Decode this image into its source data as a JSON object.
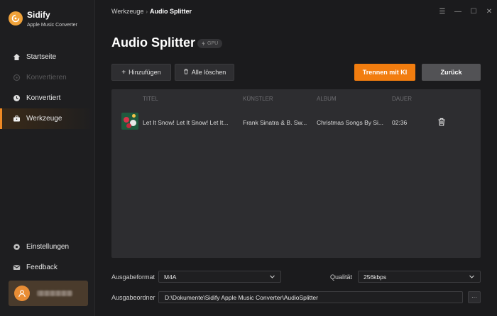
{
  "app": {
    "name": "Sidify",
    "subtitle": "Apple Music Converter",
    "accent_color": "#f27d0f"
  },
  "sidebar": {
    "items": [
      {
        "label": "Startseite",
        "icon": "home-icon",
        "state": "normal"
      },
      {
        "label": "Konvertieren",
        "icon": "convert-icon",
        "state": "disabled"
      },
      {
        "label": "Konvertiert",
        "icon": "clock-icon",
        "state": "normal"
      },
      {
        "label": "Werkzeuge",
        "icon": "toolbox-icon",
        "state": "active"
      }
    ],
    "bottom_items": [
      {
        "label": "Einstellungen",
        "icon": "gear-icon"
      },
      {
        "label": "Feedback",
        "icon": "mail-icon"
      }
    ]
  },
  "breadcrumb": {
    "parent": "Werkzeuge",
    "separator": "›",
    "current": "Audio Splitter"
  },
  "window_controls": {
    "menu": "☰",
    "minimize": "—",
    "maximize": "☐",
    "close": "✕"
  },
  "page": {
    "title": "Audio Splitter",
    "badge": "GPU"
  },
  "toolbar": {
    "add_label": "Hinzufügen",
    "clear_label": "Alle löschen",
    "split_label": "Trennen mit KI",
    "back_label": "Zurück"
  },
  "table": {
    "columns": [
      "TITEL",
      "KÜNSTLER",
      "ALBUM",
      "DAUER"
    ],
    "rows": [
      {
        "title": "Let It Snow! Let It Snow! Let It...",
        "artist": "Frank Sinatra & B. Sw...",
        "album": "Christmas Songs By Si...",
        "duration": "02:36"
      }
    ]
  },
  "settings": {
    "format_label": "Ausgabeformat",
    "format_value": "M4A",
    "quality_label": "Qualität",
    "quality_value": "256kbps",
    "folder_label": "Ausgabeordner",
    "folder_value": "D:\\Dokumente\\Sidify Apple Music Converter\\AudioSplitter",
    "browse_label": "···"
  }
}
